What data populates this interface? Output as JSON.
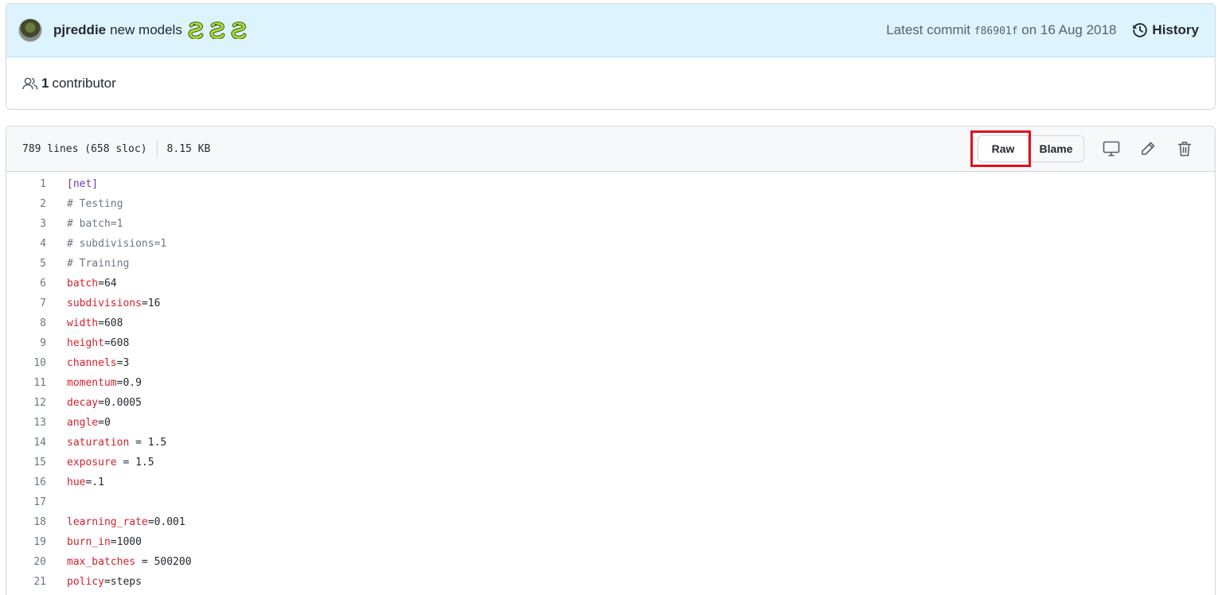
{
  "commit": {
    "author": "pjreddie",
    "message": "new models",
    "emoji_count": 3,
    "latest_label": "Latest commit",
    "sha": "f86901f",
    "date": "on 16 Aug 2018",
    "history_label": "History"
  },
  "contributors": {
    "count": "1",
    "label": "contributor"
  },
  "file": {
    "lines_info": "789 lines (658 sloc)",
    "size": "8.15 KB",
    "raw_label": "Raw",
    "blame_label": "Blame"
  },
  "code_lines": [
    {
      "n": "1",
      "type": "section",
      "text": "[net]"
    },
    {
      "n": "2",
      "type": "comment",
      "text": "# Testing"
    },
    {
      "n": "3",
      "type": "comment",
      "text": "# batch=1"
    },
    {
      "n": "4",
      "type": "comment",
      "text": "# subdivisions=1"
    },
    {
      "n": "5",
      "type": "comment",
      "text": "# Training"
    },
    {
      "n": "6",
      "type": "kv",
      "key": "batch",
      "rest": "=64"
    },
    {
      "n": "7",
      "type": "kv",
      "key": "subdivisions",
      "rest": "=16"
    },
    {
      "n": "8",
      "type": "kv",
      "key": "width",
      "rest": "=608"
    },
    {
      "n": "9",
      "type": "kv",
      "key": "height",
      "rest": "=608"
    },
    {
      "n": "10",
      "type": "kv",
      "key": "channels",
      "rest": "=3"
    },
    {
      "n": "11",
      "type": "kv",
      "key": "momentum",
      "rest": "=0.9"
    },
    {
      "n": "12",
      "type": "kv",
      "key": "decay",
      "rest": "=0.0005"
    },
    {
      "n": "13",
      "type": "kv",
      "key": "angle",
      "rest": "=0"
    },
    {
      "n": "14",
      "type": "kv",
      "key": "saturation",
      "rest": " = 1.5"
    },
    {
      "n": "15",
      "type": "kv",
      "key": "exposure",
      "rest": " = 1.5"
    },
    {
      "n": "16",
      "type": "kv",
      "key": "hue",
      "rest": "=.1"
    },
    {
      "n": "17",
      "type": "blank",
      "text": ""
    },
    {
      "n": "18",
      "type": "kv",
      "key": "learning_rate",
      "rest": "=0.001"
    },
    {
      "n": "19",
      "type": "kv",
      "key": "burn_in",
      "rest": "=1000"
    },
    {
      "n": "20",
      "type": "kv",
      "key": "max_batches",
      "rest": " = 500200"
    },
    {
      "n": "21",
      "type": "kv",
      "key": "policy",
      "rest": "=steps"
    }
  ],
  "colors": {
    "section": "#6639ba",
    "comment": "#6e7781",
    "key": "#cf222e",
    "highlight": "#e0101e",
    "commit_bg": "#ddf4ff"
  }
}
